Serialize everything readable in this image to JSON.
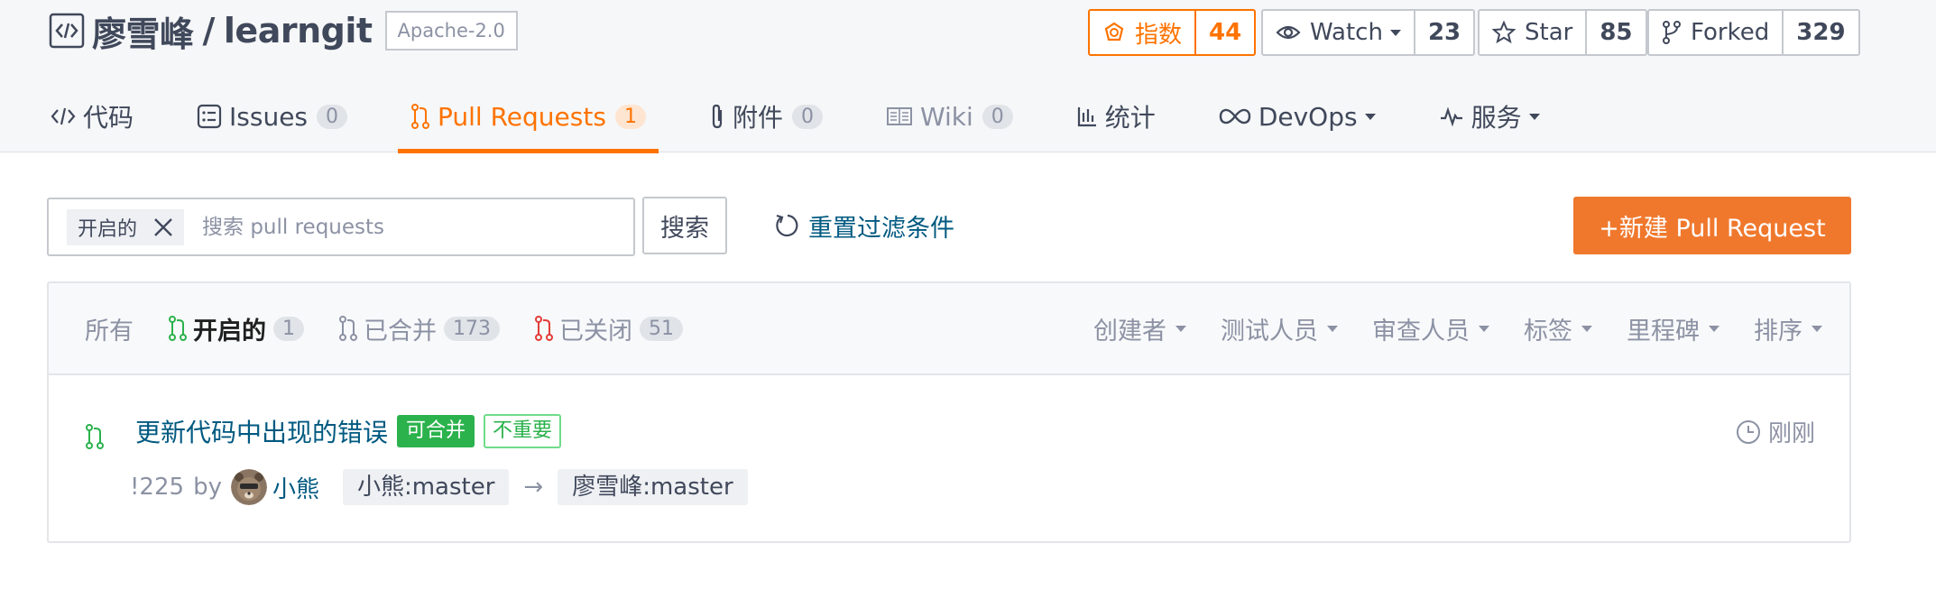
{
  "repo": {
    "owner": "廖雪峰",
    "separator": "/",
    "name": "learngit",
    "license": "Apache-2.0"
  },
  "actions": {
    "index": {
      "label": "指数",
      "count": "44",
      "icon": "medal-icon"
    },
    "watch": {
      "label": "Watch",
      "count": "23",
      "icon": "eye-icon"
    },
    "star": {
      "label": "Star",
      "count": "85",
      "icon": "star-icon"
    },
    "fork": {
      "label": "Forked",
      "count": "329",
      "icon": "fork-icon"
    }
  },
  "tabs": [
    {
      "label": "代码",
      "count": null,
      "icon": "code-icon"
    },
    {
      "label": "Issues",
      "count": "0",
      "icon": "issues-icon"
    },
    {
      "label": "Pull Requests",
      "count": "1",
      "icon": "pull-request-icon",
      "active": true
    },
    {
      "label": "附件",
      "count": "0",
      "icon": "paperclip-icon"
    },
    {
      "label": "Wiki",
      "count": "0",
      "icon": "book-icon"
    },
    {
      "label": "统计",
      "count": null,
      "icon": "bar-chart-icon"
    },
    {
      "label": "DevOps",
      "count": null,
      "icon": "infinity-icon"
    },
    {
      "label": "服务",
      "count": null,
      "icon": "pulse-icon"
    }
  ],
  "search": {
    "filter_chip": "开启的",
    "placeholder": "搜索 pull requests",
    "value": "",
    "button_label": "搜索",
    "reset_label": "重置过滤条件",
    "new_pr_label": "+新建 Pull Request"
  },
  "state_tabs": [
    {
      "label": "所有",
      "count": null
    },
    {
      "label": "开启的",
      "count": "1",
      "current": true
    },
    {
      "label": "已合并",
      "count": "173"
    },
    {
      "label": "已关闭",
      "count": "51"
    }
  ],
  "head_filters": [
    "创建者",
    "测试人员",
    "审查人员",
    "标签",
    "里程碑",
    "排序"
  ],
  "pull_requests": [
    {
      "title": "更新代码中出现的错误",
      "tags": [
        "可合并",
        "不重要"
      ],
      "time": "刚刚",
      "number": "!225",
      "by": "by",
      "author": "小熊",
      "source_branch": "小熊:master",
      "arrow": "→",
      "target_branch": "廖雪峰:master"
    }
  ],
  "colors": {
    "accent": "#fe7300",
    "link": "#005980",
    "success": "#2bb24c",
    "closed": "#e23c39"
  }
}
